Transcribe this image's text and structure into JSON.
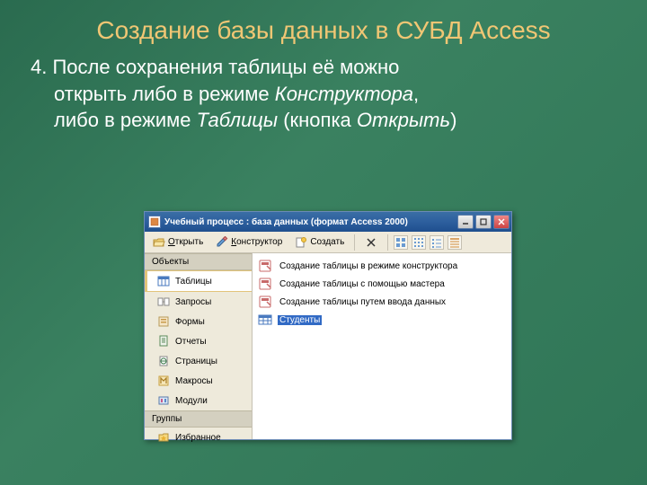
{
  "slide": {
    "title": "Создание базы данных в СУБД Access",
    "bullet_number": "4.",
    "line1": "После сохранения таблицы её можно",
    "line2_a": "открыть либо в режиме ",
    "line2_em": "Конструктора",
    "line2_b": ",",
    "line3_a": "либо в режиме ",
    "line3_em1": "Таблицы",
    "line3_b": " (кнопка ",
    "line3_em2": "Открыть",
    "line3_c": ")"
  },
  "window": {
    "title": "Учебный процесс : база данных (формат Access 2000)"
  },
  "toolbar": {
    "open_label": "Открыть",
    "open_u": "О",
    "design_label": "онструктор",
    "design_u": "К",
    "create_label": "Создать"
  },
  "sidebar": {
    "header_objects": "Объекты",
    "tables": "Таблицы",
    "queries": "Запросы",
    "forms": "Формы",
    "reports": "Отчеты",
    "pages": "Страницы",
    "macros": "Макросы",
    "modules": "Модули",
    "header_groups": "Группы",
    "favorites": "Избранное"
  },
  "content": {
    "wizard1": "Создание таблицы в режиме конструктора",
    "wizard2": "Создание таблицы с помощью мастера",
    "wizard3": "Создание таблицы путем ввода данных",
    "table1": "Студенты"
  }
}
